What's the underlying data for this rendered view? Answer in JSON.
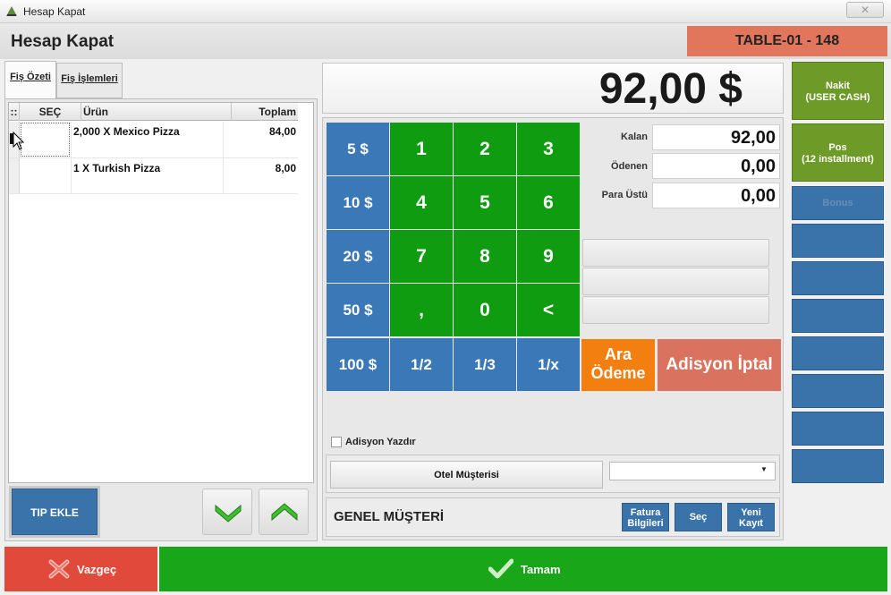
{
  "window": {
    "title": "Hesap Kapat",
    "close_label": "✕"
  },
  "header": {
    "page_title": "Hesap Kapat",
    "table_label": "TABLE-01 - 148"
  },
  "tabs": [
    {
      "label": "Fiş Özeti"
    },
    {
      "label": "Fiş İşlemleri"
    }
  ],
  "grid": {
    "columns": [
      "::",
      "SEÇ",
      "Ürün",
      "Toplam"
    ],
    "rows": [
      {
        "product": "2,000 X Mexico Pizza",
        "total": "84,00"
      },
      {
        "product": "1 X Turkish Pizza",
        "total": "8,00"
      }
    ]
  },
  "left_actions": {
    "tip_label": "TIP EKLE"
  },
  "amount": {
    "display": "92,00 $"
  },
  "keypad": {
    "money_keys": [
      "5 $",
      "10 $",
      "20 $",
      "50 $",
      "100 $"
    ],
    "number_rows": [
      [
        "1",
        "2",
        "3"
      ],
      [
        "4",
        "5",
        "6"
      ],
      [
        "7",
        "8",
        "9"
      ],
      [
        ",",
        "0",
        "<"
      ]
    ],
    "fraction_keys": [
      "1/2",
      "1/3",
      "1/x"
    ]
  },
  "summary": {
    "kalan_label": "Kalan",
    "kalan_value": "92,00",
    "odenen_label": "Ödenen",
    "odenen_value": "0,00",
    "para_ustu_label": "Para Üstü",
    "para_ustu_value": "0,00"
  },
  "actions": {
    "ara_line1": "Ara",
    "ara_line2": "Ödeme",
    "iptal_label": "Adisyon İptal"
  },
  "print_option": {
    "label": "Adisyon Yazdır",
    "checked": false
  },
  "hotel": {
    "button_label": "Otel Müşterisi",
    "dropdown_value": ""
  },
  "customer": {
    "name": "GENEL MÜŞTERİ",
    "fatura_line1": "Fatura",
    "fatura_line2": "Bilgileri",
    "sec_label": "Seç",
    "yeni_line1": "Yeni",
    "yeni_line2": "Kayıt"
  },
  "payment_methods": [
    {
      "line1": "Nakit",
      "line2": "(USER CASH)"
    },
    {
      "line1": "Pos",
      "line2": "(12 installment)"
    },
    {
      "line1": "Bonus",
      "line2": ""
    }
  ],
  "footer": {
    "cancel_label": "Vazgeç",
    "ok_label": "Tamam"
  },
  "colors": {
    "green_key": "#109c10",
    "blue_key": "#3a78b8",
    "badge": "#e1765c",
    "orange": "#f27f10",
    "cancel_red": "#e1493b",
    "ok_green": "#19a619"
  }
}
